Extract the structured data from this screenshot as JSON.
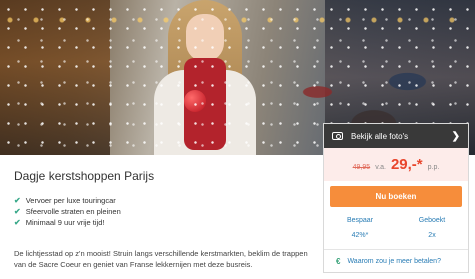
{
  "hero": {
    "photos_label": "Bekijk alle foto's",
    "camera_icon": "camera-icon",
    "chevron_icon": "chevron-right-icon"
  },
  "pricing": {
    "old_price": "49,95",
    "va_label": "v.a.",
    "new_price": "29,-*",
    "pp_label": "p.p."
  },
  "booking": {
    "button_label": "Nu boeken",
    "stats": [
      {
        "label": "Bespaar",
        "value": "42%*"
      },
      {
        "label": "Geboekt",
        "value": "2x"
      }
    ],
    "pay_icon": "euro-icon",
    "pay_label": "Waarom zou je meer betalen?"
  },
  "product": {
    "title": "Dagje kerstshoppen Parijs",
    "features": [
      "Vervoer per luxe touringcar",
      "Sfeervolle straten en pleinen",
      "Minimaal 9 uur vrije tijd!"
    ],
    "description": "De lichtjesstad op z'n mooist! Struin langs verschillende kerstmarkten, beklim de trappen van de Sacre Coeur en geniet van Franse lekkernijen met deze busreis."
  },
  "colors": {
    "accent_orange": "#f68d3b",
    "price_red": "#e8452c",
    "link_blue": "#2a7db5",
    "check_green": "#3aa98a"
  }
}
